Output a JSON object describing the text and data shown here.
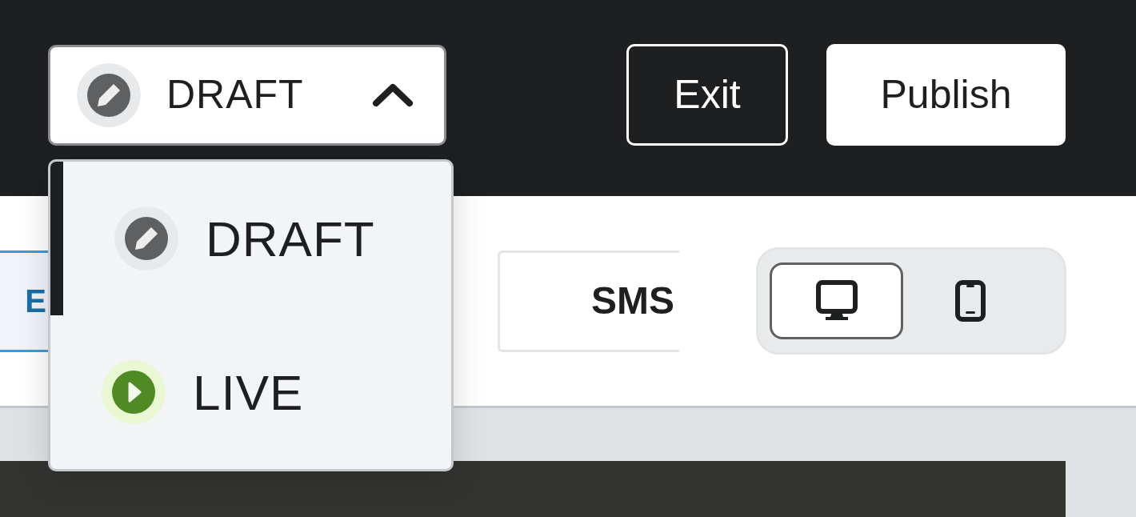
{
  "status_menu": {
    "value": "DRAFT",
    "expanded": true,
    "options": [
      {
        "label": "DRAFT",
        "kind": "draft",
        "selected": true
      },
      {
        "label": "LIVE",
        "kind": "live",
        "selected": false
      }
    ]
  },
  "buttons": [
    {
      "label": "Exit",
      "kind": "outline"
    },
    {
      "label": "Publish",
      "kind": "solid"
    }
  ],
  "channel_tabs": [
    {
      "label": "E",
      "selected": true
    },
    {
      "label": "SMS",
      "selected": false
    }
  ],
  "device_toggle": [
    {
      "kind": "desktop",
      "selected": true
    },
    {
      "kind": "mobile",
      "selected": false
    }
  ]
}
